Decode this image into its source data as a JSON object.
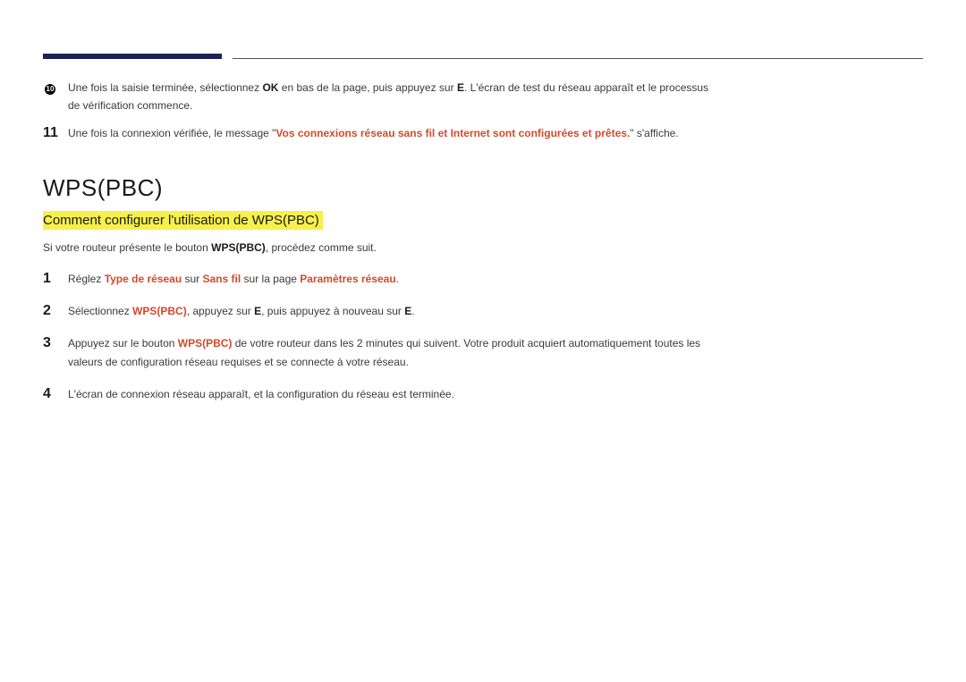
{
  "top": {
    "item10": {
      "num": "10",
      "text_pre": "Une fois la saisie terminée, sélectionnez ",
      "ok": "OK",
      "text_mid": " en bas de la page, puis appuyez sur ",
      "e": "E",
      "text_post": ". L'écran de test du réseau apparaît et le processus de vérification commence."
    },
    "item11": {
      "num": "11",
      "text_pre": "Une fois la connexion vérifiée, le message \"",
      "msg": "Vos connexions réseau sans fil et Internet sont configurées et prêtes.",
      "text_post": "\" s'affiche."
    }
  },
  "section": {
    "title": "WPS(PBC)",
    "subtitle": "Comment configurer l'utilisation de WPS(PBC)",
    "intro_pre": "Si votre routeur présente le bouton ",
    "intro_bold": "WPS(PBC)",
    "intro_post": ", procédez comme suit."
  },
  "steps": {
    "s1": {
      "num": "1",
      "pre": "Réglez ",
      "red1": "Type de réseau",
      "mid1": " sur ",
      "red2": "Sans fil",
      "mid2": " sur la page ",
      "red3": "Paramètres réseau",
      "post": "."
    },
    "s2": {
      "num": "2",
      "pre": "Sélectionnez ",
      "red": "WPS(PBC)",
      "mid1": ", appuyez sur ",
      "e1": "E",
      "mid2": ", puis appuyez à nouveau sur ",
      "e2": "E",
      "post": "."
    },
    "s3": {
      "num": "3",
      "pre": "Appuyez sur le bouton ",
      "red": "WPS(PBC)",
      "mid": " de votre routeur dans les 2 minutes qui suivent. Votre produit acquiert automatiquement toutes les valeurs de configuration réseau requises et se connecte à votre réseau."
    },
    "s4": {
      "num": "4",
      "text": "L'écran de connexion réseau apparaît, et la configuration du réseau est terminée."
    }
  }
}
